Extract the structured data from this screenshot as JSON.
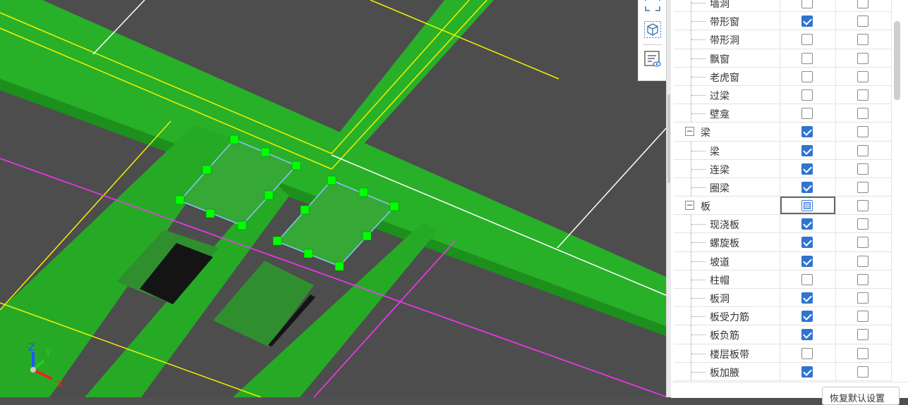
{
  "axis": {
    "x": "X",
    "y": "Y",
    "z": "Z"
  },
  "colors": {
    "wall": "#22a722",
    "wall_top": "#25ad25",
    "select_handle": "#00ff00",
    "axis_yellow": "#f4f000",
    "axis_magenta": "#ff33ff",
    "axis_white": "#ffffff",
    "background": "#4d4d4d",
    "check": "#2f74d0"
  },
  "toolbar": {
    "tools": [
      {
        "name": "fit-view",
        "icon": "frame-icon"
      },
      {
        "name": "3d-view",
        "icon": "cube-icon"
      },
      {
        "name": "display-settings",
        "icon": "list-eye-icon"
      }
    ]
  },
  "tree": {
    "rows": [
      {
        "label": "墙洞",
        "level": "child",
        "show": false,
        "col2": false
      },
      {
        "label": "带形窗",
        "level": "child",
        "show": true,
        "col2": false
      },
      {
        "label": "带形洞",
        "level": "child",
        "show": false,
        "col2": false
      },
      {
        "label": "飘窗",
        "level": "child",
        "show": false,
        "col2": false
      },
      {
        "label": "老虎窗",
        "level": "child",
        "show": false,
        "col2": false
      },
      {
        "label": "过梁",
        "level": "child",
        "show": false,
        "col2": false
      },
      {
        "label": "壁龛",
        "level": "child",
        "show": false,
        "col2": false
      },
      {
        "label": "梁",
        "level": "group",
        "show": true,
        "col2": false,
        "expander": "−"
      },
      {
        "label": "梁",
        "level": "child",
        "show": true,
        "col2": false
      },
      {
        "label": "连梁",
        "level": "child",
        "show": true,
        "col2": false
      },
      {
        "label": "圈梁",
        "level": "child",
        "show": true,
        "col2": false
      },
      {
        "label": "板",
        "level": "group",
        "show": "partial",
        "col2": false,
        "expander": "−",
        "focus": true
      },
      {
        "label": "现浇板",
        "level": "child",
        "show": true,
        "col2": false
      },
      {
        "label": "螺旋板",
        "level": "child",
        "show": true,
        "col2": false
      },
      {
        "label": "坡道",
        "level": "child",
        "show": true,
        "col2": false
      },
      {
        "label": "柱帽",
        "level": "child",
        "show": false,
        "col2": false
      },
      {
        "label": "板洞",
        "level": "child",
        "show": true,
        "col2": false
      },
      {
        "label": "板受力筋",
        "level": "child",
        "show": true,
        "col2": false
      },
      {
        "label": "板负筋",
        "level": "child",
        "show": true,
        "col2": false
      },
      {
        "label": "楼层板带",
        "level": "child",
        "show": false,
        "col2": false
      },
      {
        "label": "板加腋",
        "level": "child",
        "show": true,
        "col2": false
      }
    ]
  },
  "footer": {
    "restore_label": "恢复默认设置"
  }
}
